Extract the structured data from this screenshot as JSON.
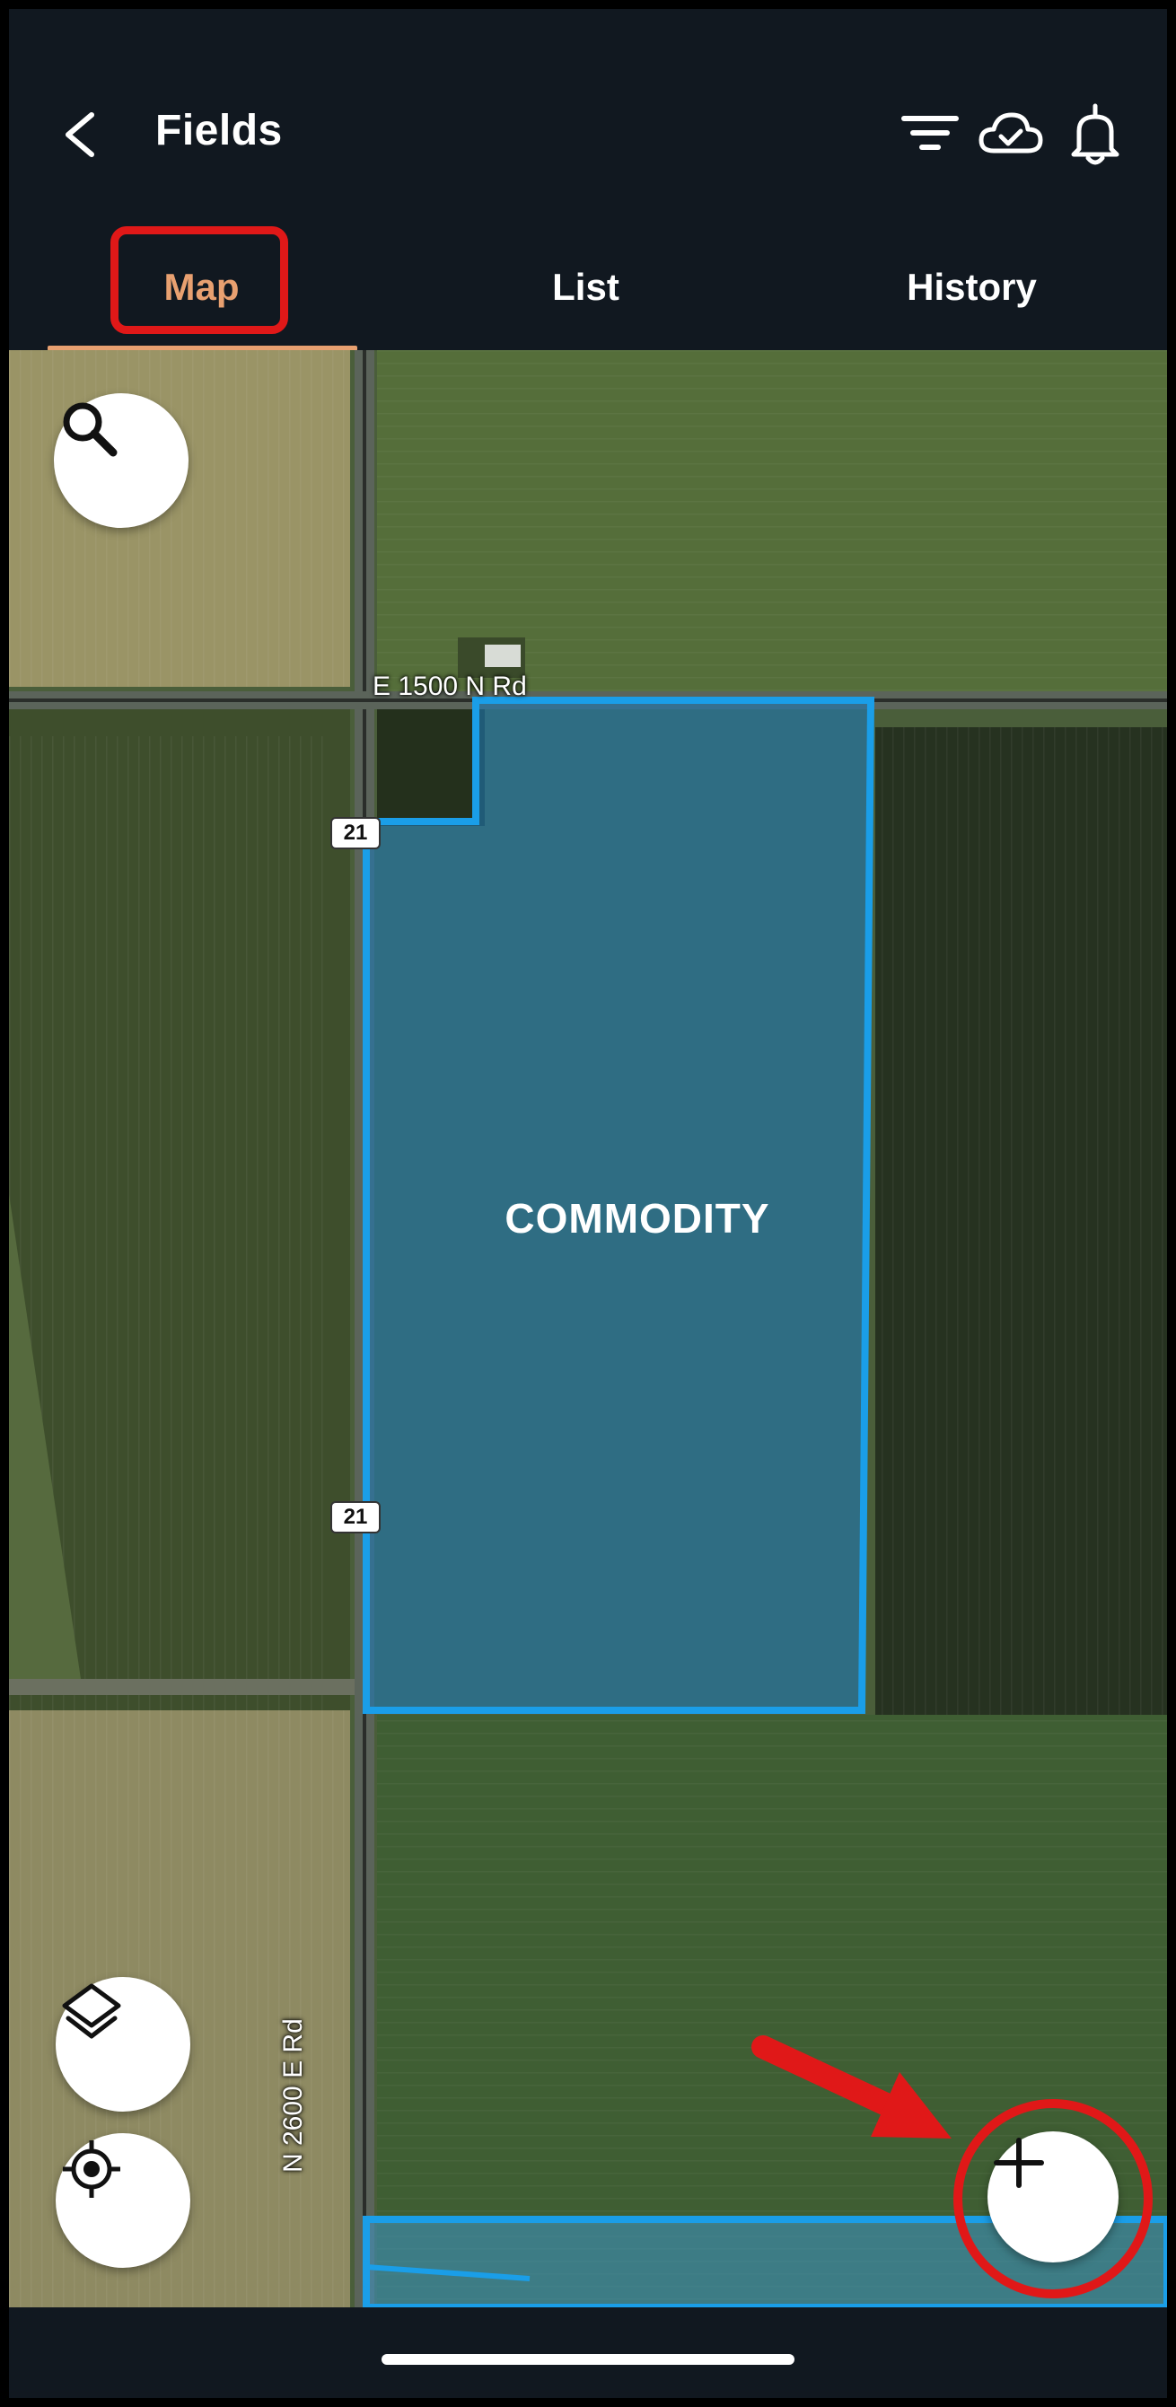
{
  "header": {
    "title": "Fields",
    "icons": {
      "back": "chevron-left-icon",
      "filter": "filter-icon",
      "sync": "cloud-check-icon",
      "notifications": "bell-icon"
    }
  },
  "tabs": [
    {
      "label": "Map",
      "active": true
    },
    {
      "label": "List",
      "active": false
    },
    {
      "label": "History",
      "active": false
    }
  ],
  "map": {
    "road_top": "E 1500 N Rd",
    "road_side": "N 2600 E Rd",
    "route_shield": "21",
    "field_name": "COMMODITY",
    "buttons": {
      "search": "search-icon",
      "layers": "layers-icon",
      "locate": "crosshair-icon",
      "add": "plus-icon"
    }
  },
  "colors": {
    "accent": "#e8a070",
    "field_outline": "#1a9ee8",
    "annotation": "#e01818",
    "header_bg": "#111820"
  }
}
